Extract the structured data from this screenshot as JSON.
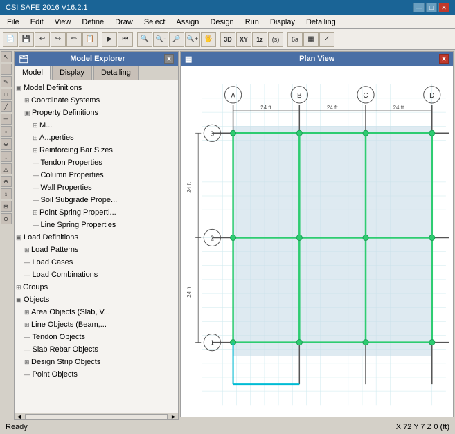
{
  "app": {
    "title": "CSI SAFE 2016 V16.2.1",
    "win_controls": [
      "—",
      "□",
      "✕"
    ]
  },
  "menu": {
    "items": [
      "File",
      "Edit",
      "View",
      "Define",
      "Draw",
      "Select",
      "Assign",
      "Design",
      "Run",
      "Display",
      "Detailing"
    ]
  },
  "toolbar": {
    "buttons": [
      "📁",
      "💾",
      "↩",
      "↪",
      "✏",
      "📋",
      "▶",
      "⏮",
      "🔍",
      "🔍",
      "🔍",
      "🔍",
      "🖐",
      "3D",
      "XY",
      "1z",
      "(s)",
      "6a",
      "▦",
      "✓"
    ],
    "labels": [
      "3D",
      "XY",
      "1z"
    ]
  },
  "model_explorer": {
    "title": "Model Explorer",
    "close": "✕",
    "tabs": [
      "Model",
      "Display",
      "Detailing"
    ],
    "active_tab": "Model",
    "tree": [
      {
        "label": "Model Definitions",
        "level": 1,
        "type": "minus"
      },
      {
        "label": "Coordinate Systems",
        "level": 2,
        "type": "plus"
      },
      {
        "label": "Property Definitions",
        "level": 2,
        "type": "minus"
      },
      {
        "label": "M...",
        "level": 3,
        "type": "plus"
      },
      {
        "label": "A...perties",
        "level": 3,
        "type": "plus"
      },
      {
        "label": "Reinforcing Bar Sizes",
        "level": 3,
        "type": "plus"
      },
      {
        "label": "Tendon Properties",
        "level": 3,
        "type": "dash"
      },
      {
        "label": "Column Properties",
        "level": 3,
        "type": "dash"
      },
      {
        "label": "Wall Properties",
        "level": 3,
        "type": "dash"
      },
      {
        "label": "Soil Subgrade Prope...",
        "level": 3,
        "type": "dash"
      },
      {
        "label": "Point Spring Properti...",
        "level": 3,
        "type": "plus"
      },
      {
        "label": "Line Spring Properties",
        "level": 3,
        "type": "dash"
      },
      {
        "label": "Load Definitions",
        "level": 1,
        "type": "minus"
      },
      {
        "label": "Load Patterns",
        "level": 2,
        "type": "plus"
      },
      {
        "label": "Load Cases",
        "level": 2,
        "type": "dash"
      },
      {
        "label": "Load Combinations",
        "level": 2,
        "type": "dash"
      },
      {
        "label": "Groups",
        "level": 1,
        "type": "plus"
      },
      {
        "label": "Objects",
        "level": 1,
        "type": "minus"
      },
      {
        "label": "Area Objects (Slab, V...",
        "level": 2,
        "type": "plus"
      },
      {
        "label": "Line Objects (Beam,...",
        "level": 2,
        "type": "plus"
      },
      {
        "label": "Tendon Objects",
        "level": 2,
        "type": "dash"
      },
      {
        "label": "Slab Rebar Objects",
        "level": 2,
        "type": "dash"
      },
      {
        "label": "Design Strip Objects",
        "level": 2,
        "type": "plus"
      },
      {
        "label": "Point Objects",
        "level": 2,
        "type": "dash"
      }
    ]
  },
  "plan_view": {
    "title": "Plan View",
    "close": "✕",
    "grid_labels_x": [
      "A",
      "B",
      "C",
      "D"
    ],
    "grid_labels_y": [
      "1",
      "2",
      "3"
    ],
    "dim_labels": [
      "24 ft",
      "24 ft",
      "24 ft"
    ],
    "dim_vert": [
      "24 ft",
      "24 ft"
    ]
  },
  "status_bar": {
    "left": "Ready",
    "right": "X 72  Y 7  Z 0  (ft)"
  }
}
